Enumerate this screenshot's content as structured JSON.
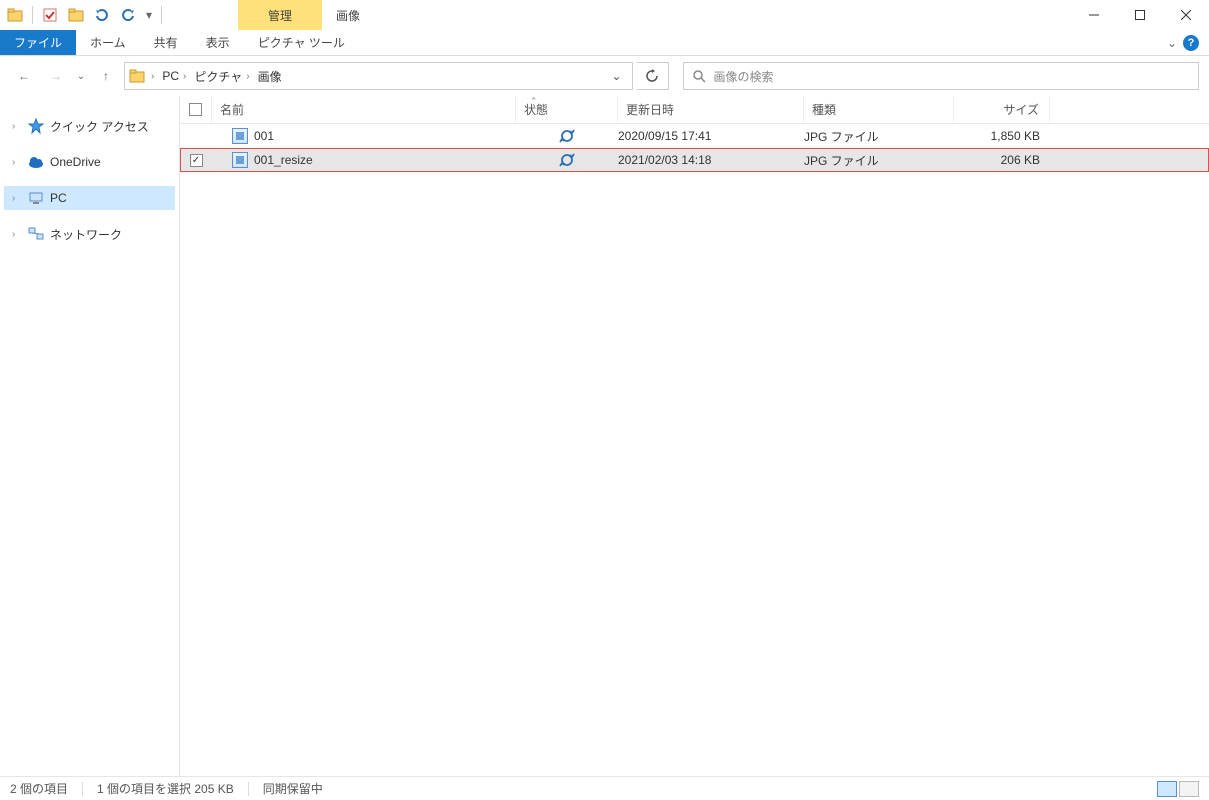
{
  "titlebar": {
    "context_tab": "管理",
    "title": "画像"
  },
  "ribbon": {
    "file": "ファイル",
    "tabs": [
      "ホーム",
      "共有",
      "表示"
    ],
    "tool_tab": "ピクチャ ツール"
  },
  "address": {
    "crumbs": [
      "PC",
      "ピクチャ",
      "画像"
    ]
  },
  "search": {
    "placeholder": "画像の検索"
  },
  "tree": {
    "items": [
      {
        "label": "クイック アクセス",
        "icon": "star"
      },
      {
        "label": "OneDrive",
        "icon": "cloud"
      },
      {
        "label": "PC",
        "icon": "pc",
        "selected": true
      },
      {
        "label": "ネットワーク",
        "icon": "network"
      }
    ]
  },
  "columns": {
    "name": "名前",
    "status": "状態",
    "date": "更新日時",
    "type": "種類",
    "size": "サイズ"
  },
  "rows": [
    {
      "checked": false,
      "name": "001",
      "status": "sync",
      "date": "2020/09/15 17:41",
      "type": "JPG ファイル",
      "size": "1,850 KB",
      "selected": false
    },
    {
      "checked": true,
      "name": "001_resize",
      "status": "sync",
      "date": "2021/02/03 14:18",
      "type": "JPG ファイル",
      "size": "206 KB",
      "selected": true
    }
  ],
  "status": {
    "count": "2 個の項目",
    "selection": "1 個の項目を選択 205 KB",
    "sync": "同期保留中"
  }
}
